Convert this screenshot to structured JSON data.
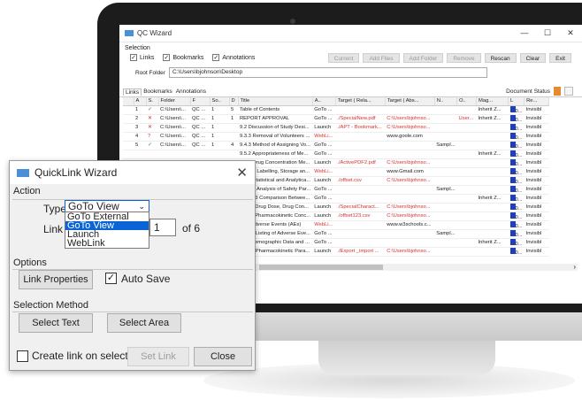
{
  "app": {
    "title": "QC Wizard",
    "window_controls": [
      "—",
      "☐",
      "✕"
    ]
  },
  "selection": {
    "label": "Selection",
    "links": "Links",
    "bookmarks": "Bookmarks",
    "annotations": "Annotations"
  },
  "toolbar": [
    "Current",
    "Add Files",
    "Add Folder",
    "Remove",
    "Rescan",
    "Clear",
    "Exit"
  ],
  "root_folder": {
    "label": "Root Folder",
    "value": "C:\\Users\\bjohnson\\Desktop"
  },
  "tabs": [
    "Links",
    "Bookmarks",
    "Annotations"
  ],
  "doc_status": "Document Status",
  "grid": {
    "headers": [
      "A",
      "S.",
      "Folder",
      "F",
      "So..",
      "D",
      "Title",
      "A..",
      "Target ( Rela...",
      "Target ( Abs...",
      "N..",
      "O..",
      "Mag...",
      "L",
      "Re..."
    ],
    "rows": [
      [
        "1",
        "✓",
        "C:\\Users\\...",
        "QC ...",
        "1",
        "5",
        "Table of Contents",
        "GoTo ...",
        "",
        "",
        "",
        "",
        "Inherit Z...",
        "0...",
        "Invisibl"
      ],
      [
        "2",
        "✕",
        "C:\\Users\\...",
        "QC ...",
        "1",
        "1",
        "REPORT APPROVAL",
        "GoTo ...",
        "./SpecialNew.pdf",
        "C:\\Users\\bjohnso...",
        "",
        "User...",
        "Inherit Z...",
        "0...",
        "Invisibl"
      ],
      [
        "3",
        "✕",
        "C:\\Users\\...",
        "QC ...",
        "1",
        "",
        "9.2 Discussion of Study Desi...",
        "Launch",
        "./APT - Bookmark...",
        "C:\\Users\\bjohnso...",
        "",
        "",
        "",
        "0...",
        "Invisibl"
      ],
      [
        "4",
        "?",
        "C:\\Users\\...",
        "QC ...",
        "1",
        "",
        "9.3.3 Removal of Volunteers ...",
        "WebLi...",
        "",
        "www.goole.com",
        "",
        "",
        "",
        "0...",
        "Invisibl"
      ],
      [
        "5",
        "✓",
        "C:\\Users\\...",
        "QC ...",
        "1",
        "4",
        "9.4.3 Method of Assigning Vo...",
        "GoTo ...",
        "",
        "",
        "Sampl...",
        "",
        "",
        "0...",
        "Invisibl"
      ],
      [
        "",
        "",
        "",
        "",
        "",
        "",
        "9.5.2 Appropriateness of Me...",
        "GoTo ...",
        "",
        "",
        "",
        "",
        "Inherit Z...",
        "0...",
        "Invisibl"
      ],
      [
        "",
        "",
        "",
        "",
        "",
        "",
        "9.5.4 Drug Concentration Me...",
        "Launch",
        "./ActivePDF2.pdf",
        "C:\\Users\\bjohnso...",
        "",
        "",
        "",
        "0...",
        "Invisibl"
      ],
      [
        "",
        "",
        "",
        "",
        "",
        "",
        "9.5.4.3 Labelling, Storage an...",
        "WebLi...",
        "",
        "www.Gmail.com",
        "",
        "",
        "",
        "0...",
        "Invisibl"
      ],
      [
        "",
        "",
        "",
        "",
        "",
        "",
        "9.7.1 Statistical and Analytica...",
        "Launch",
        "./offset.csv",
        "C:\\Users\\bjohnso...",
        "",
        "",
        "",
        "0...",
        "Invisibl"
      ],
      [
        "",
        "",
        "",
        "",
        "",
        "",
        "9.7.1.4 Analysis of Safety Par...",
        "GoTo ...",
        "",
        "",
        "Sampl...",
        "",
        "",
        "0...",
        "Invisibl"
      ],
      [
        "",
        "",
        "",
        "",
        "",
        "",
        "11.4.1.3 Comparison Betwee...",
        "GoTo ...",
        "",
        "",
        "",
        "",
        "Inherit Z...",
        "0...",
        "Invisibl"
      ],
      [
        "",
        "",
        "",
        "",
        "",
        "",
        "11.4.4 Drug Dose, Drug Con...",
        "Launch",
        "./SpecialCharact...",
        "C:\\Users\\bjohnso...",
        "",
        "",
        "",
        "0...",
        "Invisibl"
      ],
      [
        "",
        "",
        "",
        "",
        "",
        "",
        "11.4.7 Pharmacokinetic Conc...",
        "Launch",
        "./offset123.csv",
        "C:\\Users\\bjohnso...",
        "",
        "",
        "",
        "0...",
        "Invisibl"
      ],
      [
        "",
        "",
        "",
        "",
        "",
        "",
        "12.2 Adverse Events (AEs)",
        "WebLi...",
        "",
        "www.w3schools.c...",
        "",
        "",
        "",
        "0...",
        "Invisibl"
      ],
      [
        "",
        "",
        "",
        "",
        "",
        "",
        "12.2.4 Listing of Adverse Eve...",
        "GoTo ...",
        "",
        "",
        "Sampl...",
        "",
        "",
        "0...",
        "Invisibl"
      ],
      [
        "",
        "",
        "",
        "",
        "",
        "",
        "14.1 Demographic Data and ...",
        "GoTo ...",
        "",
        "",
        "",
        "",
        "Inherit Z...",
        "0...",
        "Invisibl"
      ],
      [
        "",
        "",
        "",
        "",
        "",
        "",
        "14.2.2 Pharmacokinetic Para...",
        "Launch",
        "./Export _import ...",
        "C:\\Users\\bjohnso...",
        "",
        "",
        "",
        "0...",
        "Invisibl"
      ]
    ]
  },
  "dialog": {
    "title": "QuickLink Wizard",
    "action_label": "Action",
    "type_label": "Type",
    "type_value": "GoTo View",
    "type_options": [
      "GoTo External",
      "GoTo View",
      "Launch",
      "WebLink"
    ],
    "link_label": "Link",
    "link_value": "1",
    "link_of": "of 6",
    "options_label": "Options",
    "link_properties": "Link Properties",
    "auto_save": "Auto Save",
    "selection_method_label": "Selection Method",
    "select_text": "Select Text",
    "select_area": "Select Area",
    "create_link": "Create link on selection",
    "set_link": "Set Link",
    "close": "Close"
  }
}
